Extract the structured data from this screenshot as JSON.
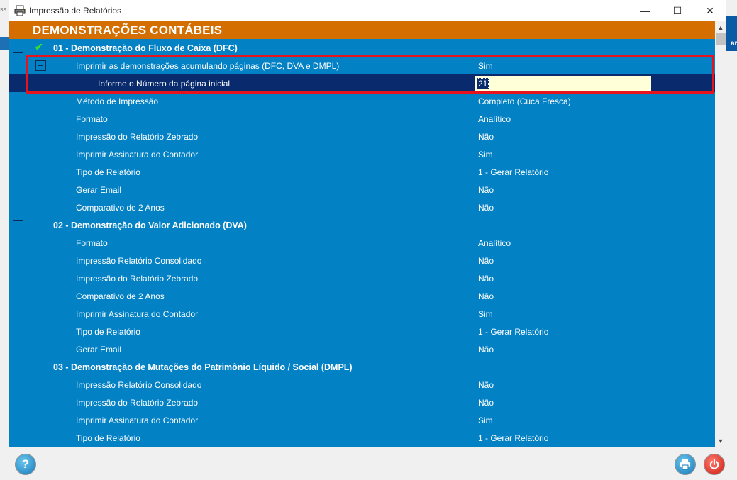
{
  "background": {
    "left_text": "sa",
    "right_text": "ar"
  },
  "window": {
    "title": "Impressão de Relatórios",
    "controls": {
      "minimize": "—",
      "maximize": "☐",
      "close": "✕"
    }
  },
  "header": {
    "title": "DEMONSTRAÇÕES CONTÁBEIS",
    "color": "#d46e00"
  },
  "colors": {
    "panel_bg": "#0281c5",
    "selected_row": "#0a2a6e",
    "highlight_border": "#e8141d",
    "input_bg": "#ffffd8"
  },
  "sections": [
    {
      "title": "01 - Demonstração do Fluxo de Caixa (DFC)",
      "checked": true,
      "group": {
        "label": "Imprimir as demonstrações acumulando páginas (DFC, DVA e DMPL)",
        "value": "Sim",
        "child": {
          "label": "Informe o Número da página inicial",
          "value": "21"
        }
      },
      "items": [
        {
          "label": "Método de Impressão",
          "value": "Completo (Cuca Fresca)"
        },
        {
          "label": "Formato",
          "value": "Analítico"
        },
        {
          "label": "Impressão do Relatório Zebrado",
          "value": "Não"
        },
        {
          "label": "Imprimir Assinatura do Contador",
          "value": "Sim"
        },
        {
          "label": "Tipo de Relatório",
          "value": "1 - Gerar Relatório"
        },
        {
          "label": "Gerar Email",
          "value": "Não"
        },
        {
          "label": "Comparativo de 2 Anos",
          "value": "Não"
        }
      ]
    },
    {
      "title": "02 - Demonstração do Valor Adicionado (DVA)",
      "items": [
        {
          "label": "Formato",
          "value": "Analítico"
        },
        {
          "label": "Impressão Relatório Consolidado",
          "value": "Não"
        },
        {
          "label": "Impressão do Relatório Zebrado",
          "value": "Não"
        },
        {
          "label": "Comparativo de 2 Anos",
          "value": "Não"
        },
        {
          "label": "Imprimir Assinatura do Contador",
          "value": "Sim"
        },
        {
          "label": "Tipo de Relatório",
          "value": "1 - Gerar Relatório"
        },
        {
          "label": "Gerar Email",
          "value": "Não"
        }
      ]
    },
    {
      "title": "03 - Demonstração de Mutações do Patrimônio Líquido / Social (DMPL)",
      "items": [
        {
          "label": "Impressão Relatório Consolidado",
          "value": "Não"
        },
        {
          "label": "Impressão do Relatório Zebrado",
          "value": "Não"
        },
        {
          "label": "Imprimir Assinatura do Contador",
          "value": "Sim"
        },
        {
          "label": "Tipo de Relatório",
          "value": "1 - Gerar Relatório"
        }
      ]
    }
  ],
  "footer": {
    "help_icon": "?",
    "print_icon": "printer-icon",
    "exit_icon": "power-icon"
  }
}
